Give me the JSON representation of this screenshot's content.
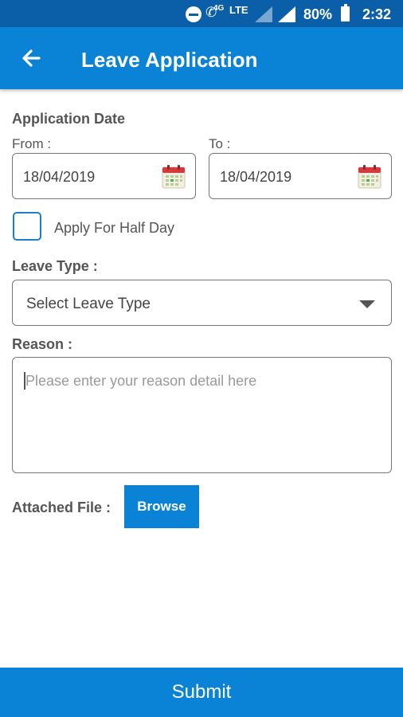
{
  "status_bar": {
    "network": "4G",
    "network_type": "LTE",
    "battery": "80%",
    "time": "2:32",
    "icons": [
      "do-not-disturb-icon",
      "wifi-calling-icon",
      "signal-icon",
      "signal-icon",
      "battery-icon"
    ]
  },
  "app_bar": {
    "title": "Leave Application",
    "back_icon": "arrow-left-icon"
  },
  "form": {
    "application_date_label": "Application Date",
    "from_label": "From :",
    "to_label": "To :",
    "from_date": "18/04/2019",
    "to_date": "18/04/2019",
    "half_day_label": "Apply For Half Day",
    "half_day_checked": false,
    "leave_type_label": "Leave Type :",
    "leave_type_value": "Select Leave Type",
    "reason_label": "Reason :",
    "reason_placeholder": "Please enter your reason detail here",
    "attached_file_label": "Attached File :",
    "browse_label": "Browse"
  },
  "footer": {
    "submit_label": "Submit"
  },
  "colors": {
    "status_bar": "#0a5fa8",
    "primary": "#0a82d6",
    "checkbox_border": "#1a7fd0",
    "calendar_red": "#d9363e"
  }
}
